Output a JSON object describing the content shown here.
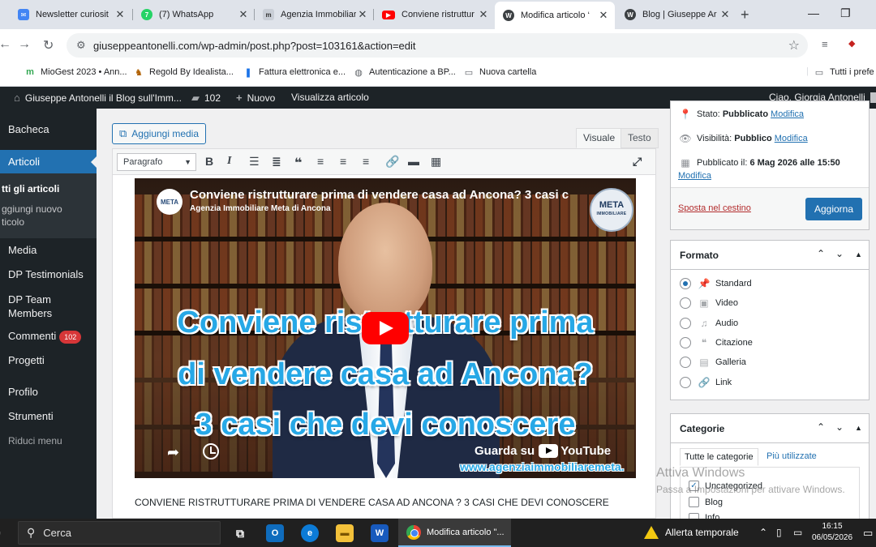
{
  "browser": {
    "tabs": [
      {
        "title": "Newsletter curiosit",
        "icon": "newsletter-icon",
        "color": "#4285f4"
      },
      {
        "title": "(7) WhatsApp",
        "icon": "whatsapp-icon",
        "color": "#25d366",
        "fav_text": "7"
      },
      {
        "title": "Agenzia Immobiliare",
        "icon": "agency-icon",
        "color": "#9aa0a6"
      },
      {
        "title": "Conviene ristruttur",
        "icon": "youtube-icon",
        "color": "#ff0000"
      },
      {
        "title": "Modifica articolo ‘",
        "icon": "wordpress-icon",
        "color": "#3c4043",
        "active": true
      },
      {
        "title": "Blog | Giuseppe Ar",
        "icon": "wordpress-icon",
        "color": "#3c4043"
      }
    ],
    "url": "giuseppeantonelli.com/wp-admin/post.php?post=103161&action=edit",
    "bookmarks": [
      {
        "label": "MioGest 2023 • Ann...",
        "icon": "miogest-icon"
      },
      {
        "label": "Regold By Idealista...",
        "icon": "regold-icon"
      },
      {
        "label": "Fattura elettronica e...",
        "icon": "fattura-icon"
      },
      {
        "label": "Autenticazione a BP...",
        "icon": "globe-icon"
      },
      {
        "label": "Nuova cartella",
        "icon": "folder-icon"
      }
    ],
    "bookmarks_other": "Tutti i prefe"
  },
  "adminbar": {
    "site_name": "Giuseppe Antonelli il Blog sull'Imm...",
    "comments_count": "102",
    "new_label": "Nuovo",
    "view_label": "Visualizza articolo",
    "greeting": "Ciao, Giorgia Antonelli"
  },
  "sidebar": {
    "bacheca": "Bacheca",
    "articoli": "Articoli",
    "sub_all": "tti gli articoli",
    "sub_new_1": "ggiungi nuovo",
    "sub_new_2": "ticolo",
    "media": "Media",
    "testimonials": "DP Testimonials",
    "team_1": "DP Team",
    "team_2": "Members",
    "commenti": "Commenti",
    "commenti_badge": "102",
    "progetti": "Progetti",
    "profilo": "Profilo",
    "strumenti": "Strumenti",
    "riduci": "Riduci menu"
  },
  "editor": {
    "add_media": "Aggiungi media",
    "tab_visual": "Visuale",
    "tab_text": "Testo",
    "format_select": "Paragrafo",
    "video": {
      "title": "Conviene ristrutturare prima di vendere casa ad Ancona? 3 casi c",
      "channel": "Agenzia Immobiliare Meta di Ancona",
      "logo_text": "META",
      "badge_top": "META",
      "badge_bottom": "IMMOBILIARE",
      "overlay_line1": "Conviene ristrutturare prima",
      "overlay_line2": "di vendere casa ad Ancona?",
      "overlay_line3": "3 casi che devi conoscere",
      "watch_on": "Guarda su",
      "watch_brand": "YouTube",
      "site": "www.agenziaimmobiliaremeta."
    },
    "body_text": "CONVIENE RISTRUTTURARE PRIMA DI VENDERE CASA AD ANCONA ? 3 CASI CHE DEVI CONOSCERE"
  },
  "publish": {
    "status_label": "Stato:",
    "status_value": "Pubblicato",
    "visibility_label": "Visibilità:",
    "visibility_value": "Pubblico",
    "published_label": "Pubblicato il:",
    "published_value": "6 Mag 2026 alle 15:50",
    "edit_link": "Modifica",
    "trash": "Sposta nel cestino",
    "update": "Aggiorna"
  },
  "format_box": {
    "title": "Formato",
    "options": [
      {
        "label": "Standard",
        "icon": "pin-icon",
        "selected": true
      },
      {
        "label": "Video",
        "icon": "video-icon",
        "selected": false
      },
      {
        "label": "Audio",
        "icon": "audio-icon",
        "selected": false
      },
      {
        "label": "Citazione",
        "icon": "quote-icon",
        "selected": false
      },
      {
        "label": "Galleria",
        "icon": "gallery-icon",
        "selected": false
      },
      {
        "label": "Link",
        "icon": "link-icon",
        "selected": false
      }
    ]
  },
  "categories_box": {
    "title": "Categorie",
    "tab_all": "Tutte le categorie",
    "tab_most": "Più utilizzate",
    "items": [
      {
        "label": "Uncategorized",
        "checked": true
      },
      {
        "label": "Blog",
        "checked": false
      },
      {
        "label": "Info",
        "checked": false
      }
    ]
  },
  "watermark": {
    "line1": "Attiva Windows",
    "line2": "Passa a Impostazioni per attivare Windows."
  },
  "taskbar": {
    "search": "Cerca",
    "chrome_app": "Modifica articolo \"...",
    "alert": "Allerta temporale",
    "time": "16:15",
    "date": "06/05/2026"
  },
  "colors": {
    "wp_blue": "#2271b1",
    "admin_dark": "#1d2327",
    "video_text_blue": "#27a8e6",
    "youtube_red": "#ff0000"
  }
}
